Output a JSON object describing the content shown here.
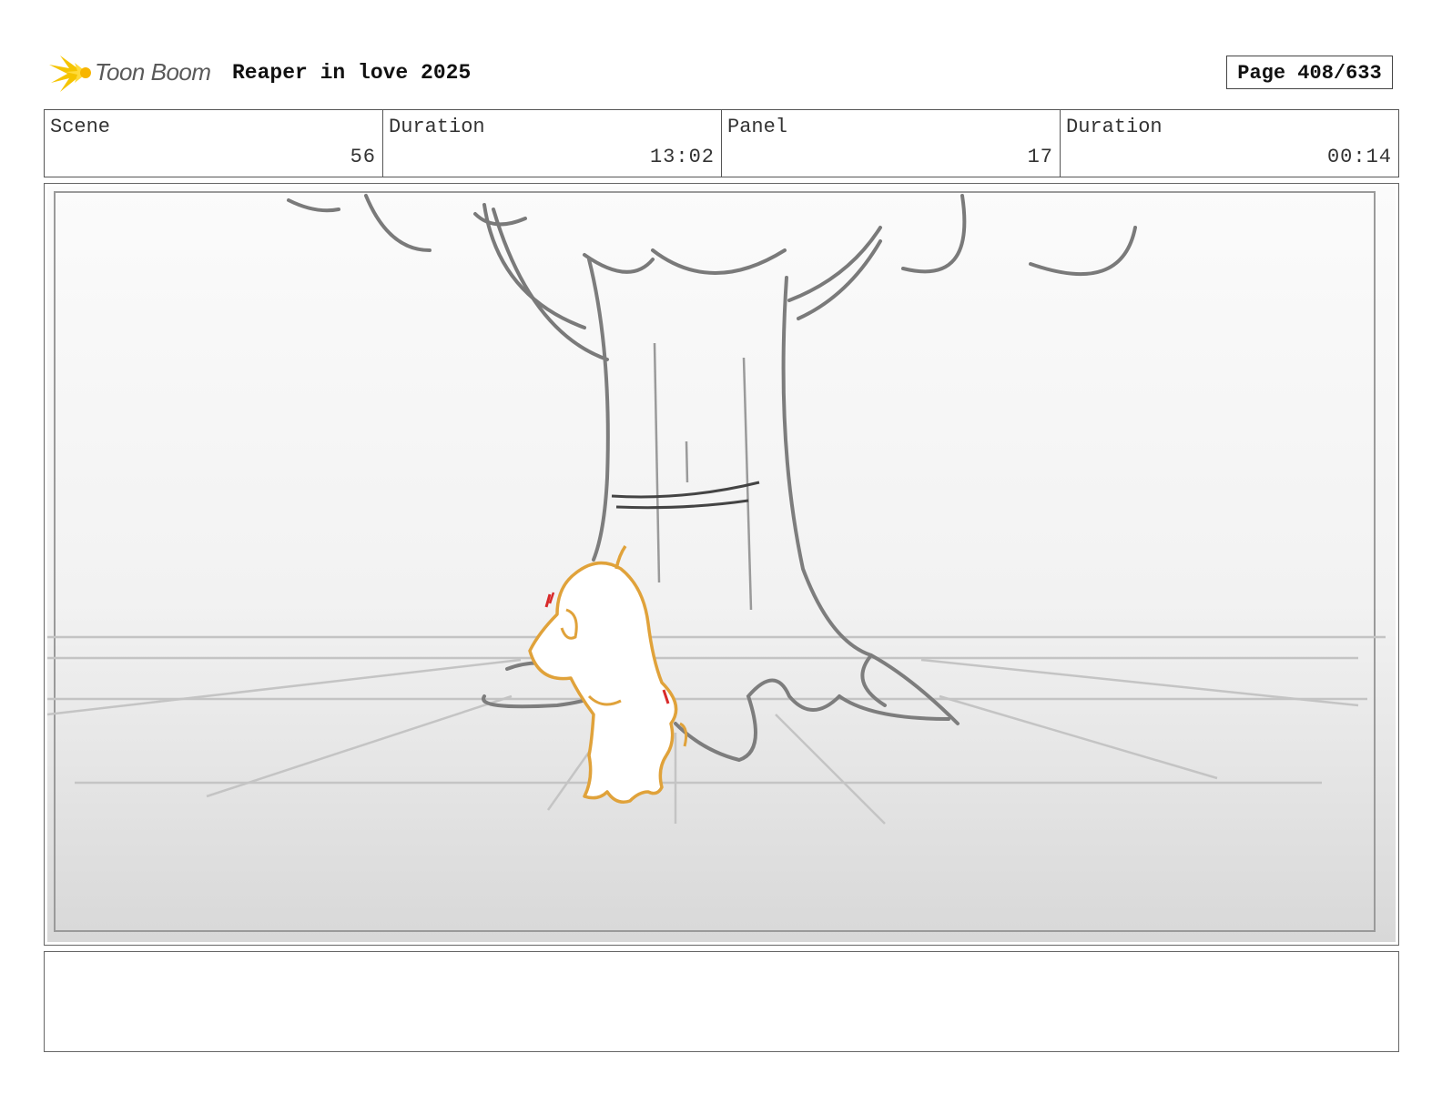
{
  "header": {
    "logo_text": "Toon Boom",
    "project_title": "Reaper in love 2025",
    "page_label": "Page 408/633"
  },
  "info": {
    "scene_label": "Scene",
    "scene_value": "56",
    "scene_duration_label": "Duration",
    "scene_duration_value": "13:02",
    "panel_label": "Panel",
    "panel_value": "17",
    "panel_duration_label": "Duration",
    "panel_duration_value": "00:14"
  },
  "colors": {
    "logo_yellow": "#f5c400",
    "sketch_gray": "#8a8a8a",
    "character_orange": "#e0a23a",
    "accent_red": "#d82a2a"
  },
  "notes": {
    "text": ""
  }
}
